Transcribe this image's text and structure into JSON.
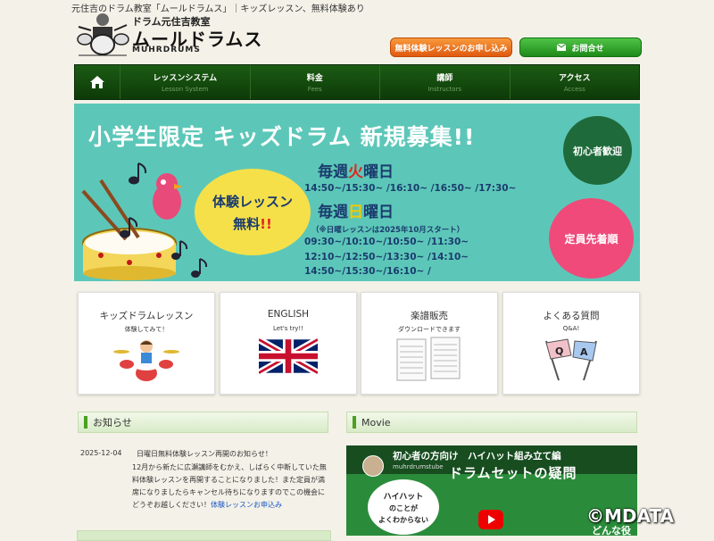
{
  "header": {
    "tagline": "元住吉のドラム教室「ムールドラムス」｜キッズレッスン、無料体験あり",
    "logo_sub": "ドラム元住吉教室",
    "logo_main": "ムールドラムス",
    "logo_en": "MUHRDRUMS",
    "trial_button": "無料体験レッスンのお申し込み",
    "contact_button": "お問合せ"
  },
  "nav": {
    "items": [
      {
        "jp": "レッスンシステム",
        "en": "Lesson System"
      },
      {
        "jp": "料金",
        "en": "Fees"
      },
      {
        "jp": "講師",
        "en": "Instructors"
      },
      {
        "jp": "アクセス",
        "en": "Access"
      }
    ]
  },
  "banner": {
    "title": "小学生限定 キッズドラム 新規募集!!",
    "day1_prefix": "毎週",
    "day1_hi": "火",
    "day1_suffix": "曜日",
    "times1": "14:50~/15:30~ /16:10~ /16:50~ /17:30~",
    "day2_prefix": "毎週",
    "day2_hi": "日",
    "day2_suffix": "曜日",
    "note": "（※日曜レッスンは2025年10月スタート）",
    "times2_a": "09:30~/10:10~/10:50~ /11:30~",
    "times2_b": "12:10~/12:50~/13:30~ /14:10~",
    "times2_c": "14:50~/15:30~/16:10~ /",
    "bubble_1": "体験レッスン",
    "bubble_2": "無料",
    "bubble_2_mark": "!!",
    "circle_green": "初心者歓迎",
    "circle_pink": "定員先着順"
  },
  "cards": [
    {
      "title": "キッズドラムレッスン",
      "sub": "体験してみて！"
    },
    {
      "title": "ENGLISH",
      "sub": "Let's try!!"
    },
    {
      "title": "楽譜販売",
      "sub": "ダウンロードできます"
    },
    {
      "title": "よくある質問",
      "sub": "Q&A!"
    }
  ],
  "news": {
    "heading": "お知らせ",
    "date": "2025-12-04",
    "title": "日曜日無料体験レッスン再開のお知らせ！",
    "body": "12月から新たに広瀬講師をむかえ、しばらく中断していた無料体験レッスンを再開することになりました！また定員が満席になりましたらキャンセル待ちになりますのでこの機会にどうぞお越しください！",
    "link": "体験レッスンお申込み"
  },
  "movie": {
    "heading": "Movie",
    "video_title": "初心者の方向け　ハイハット組み立て編",
    "channel": "muhrdrumstube",
    "headline": "ドラムセットの疑問",
    "bubble_1": "ハイハット",
    "bubble_2": "のことが",
    "bubble_3": "よくわからない",
    "tail": "どんな役に"
  },
  "watermark": "©MDATA",
  "colors": {
    "nav_bg": "#1c5c14",
    "banner_bg": "#5cc7b8",
    "trial_orange": "#f07a20",
    "contact_green": "#2ea82a"
  }
}
